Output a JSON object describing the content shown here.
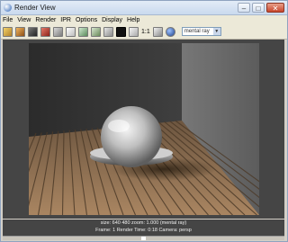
{
  "window": {
    "title": "Render View"
  },
  "menu": [
    "File",
    "View",
    "Render",
    "IPR",
    "Options",
    "Display",
    "Help"
  ],
  "toolbar": {
    "ratio_label": "1:1",
    "camera_value": "mental ray",
    "icons": [
      "redo-render-icon",
      "ipr-render-icon",
      "snapshot-icon",
      "refresh-icon",
      "region-render-icon",
      "keep-image-icon",
      "remove-image-icon",
      "rgb-channel-icon",
      "alpha-channel-icon",
      "black-swatch-icon",
      "real-size-icon",
      "ratio-label",
      "render-settings-icon",
      "camera-icon"
    ]
  },
  "status": {
    "line1": "size: 640  480 zoom: 1.000    (mental ray)",
    "line2": "Frame: 1       Render Time: 0:18       Camera: persp"
  },
  "colors": {
    "accent": "#2a63b8",
    "viewport_bg": "#454545",
    "chrome": "#d4d0c8"
  }
}
